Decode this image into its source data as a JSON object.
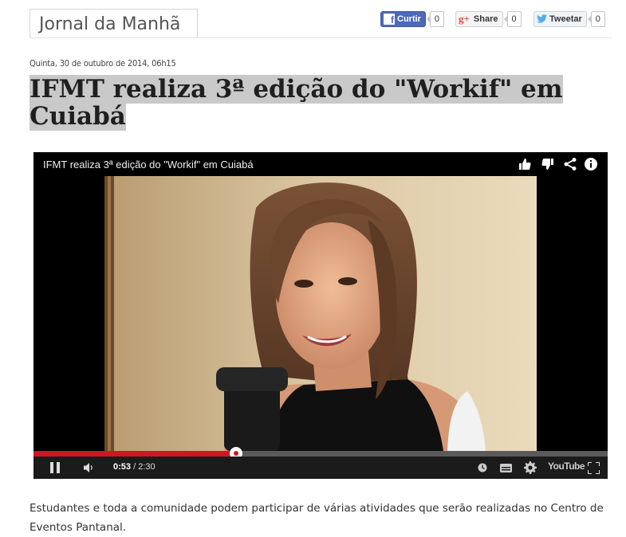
{
  "site": {
    "tab_title": "Jornal da Manhã"
  },
  "share": {
    "facebook": {
      "label": "Curtir",
      "count": "0"
    },
    "gplus": {
      "label": "Share",
      "count": "0",
      "icon": "g+"
    },
    "twitter": {
      "label": "Tweetar",
      "count": "0"
    }
  },
  "article": {
    "dateline": "Quinta, 30 de outubro de 2014, 06h15",
    "title": "IFMT realiza 3ª edição do \"Workif\" em Cuiabá",
    "body": "Estudantes e toda a comunidade podem participar de várias atividades que serão realizadas no Centro de Eventos Pantanal."
  },
  "video": {
    "title": "IFMT realiza 3ª edição do \"Workif\" em Cuiabá",
    "current_time": "0:53",
    "separator": " / ",
    "duration": "2:30",
    "progress_fraction": 0.3533,
    "youtube_label": "YouTube",
    "colors": {
      "progress": "#cc181e",
      "track": "#5a5a5a"
    },
    "icons": [
      "like-icon",
      "dislike-icon",
      "share-icon",
      "info-icon",
      "pause-icon",
      "volume-icon",
      "watch-later-icon",
      "captions-icon",
      "settings-icon",
      "youtube-logo",
      "fullscreen-icon"
    ]
  }
}
